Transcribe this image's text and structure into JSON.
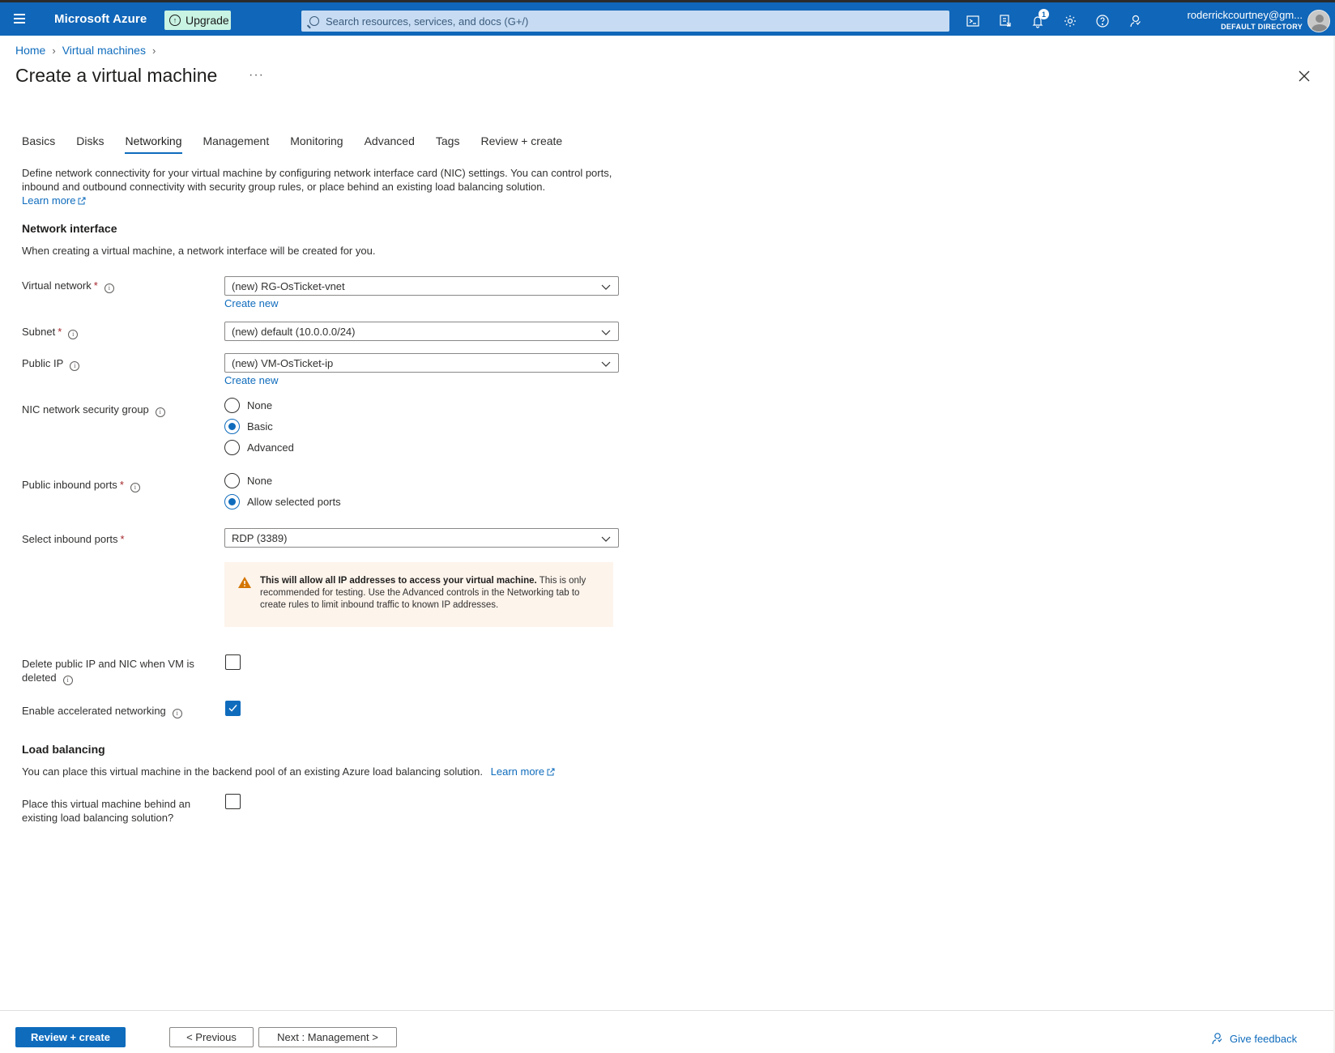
{
  "topbar": {
    "brand": "Microsoft Azure",
    "upgrade_label": "Upgrade",
    "search_placeholder": "Search resources, services, and docs (G+/)",
    "notification_count": "1",
    "account_email": "roderrickcourtney@gm...",
    "account_directory": "DEFAULT DIRECTORY",
    "icons": [
      "cloud-shell-icon",
      "directory-filter-icon",
      "notifications-icon",
      "settings-icon",
      "help-icon",
      "feedback-icon"
    ]
  },
  "breadcrumb": {
    "home": "Home",
    "virtual_machines": "Virtual machines"
  },
  "page": {
    "title": "Create a virtual machine",
    "more": "···"
  },
  "tabs": [
    "Basics",
    "Disks",
    "Networking",
    "Management",
    "Monitoring",
    "Advanced",
    "Tags",
    "Review + create"
  ],
  "active_tab": "Networking",
  "intro": {
    "text": "Define network connectivity for your virtual machine by configuring network interface card (NIC) settings. You can control ports, inbound and outbound connectivity with security group rules, or place behind an existing load balancing solution.",
    "learn_more": "Learn more"
  },
  "network_interface": {
    "title": "Network interface",
    "description": "When creating a virtual machine, a network interface will be created for you.",
    "virtual_network": {
      "label": "Virtual network",
      "value": "(new) RG-OsTicket-vnet",
      "create_new": "Create new"
    },
    "subnet": {
      "label": "Subnet",
      "value": "(new) default (10.0.0.0/24)"
    },
    "public_ip": {
      "label": "Public IP",
      "value": "(new) VM-OsTicket-ip",
      "create_new": "Create new"
    },
    "nsg": {
      "label": "NIC network security group",
      "options": [
        "None",
        "Basic",
        "Advanced"
      ],
      "selected": "Basic"
    },
    "inbound_ports": {
      "label": "Public inbound ports",
      "options": [
        "None",
        "Allow selected ports"
      ],
      "selected": "Allow selected ports"
    },
    "select_ports": {
      "label": "Select inbound ports",
      "value": "RDP (3389)"
    },
    "warning": {
      "bold": "This will allow all IP addresses to access your virtual machine.",
      "text": " This is only recommended for testing.  Use the Advanced controls in the Networking tab to create rules to limit inbound traffic to known IP addresses."
    },
    "delete_ip": {
      "label_line1": "Delete public IP and NIC when VM is",
      "label_line2": "deleted",
      "checked": false
    },
    "accelerated": {
      "label": "Enable accelerated networking",
      "checked": true
    }
  },
  "load_balancing": {
    "title": "Load balancing",
    "description": "You can place this virtual machine in the backend pool of an existing Azure load balancing solution.",
    "learn_more": "Learn more",
    "place_behind": {
      "label_line1": "Place this virtual machine behind an",
      "label_line2": "existing load balancing solution?",
      "checked": false
    }
  },
  "footer": {
    "review_create": "Review + create",
    "previous": "< Previous",
    "next": "Next : Management >",
    "give_feedback": "Give feedback"
  },
  "colors": {
    "azure_blue": "#1066b8",
    "link": "#0f6cbd",
    "upgrade_bg": "#c9f3e3",
    "warning_bg": "#fdf4ec",
    "warning_icon": "#d47500",
    "required": "#a4262c"
  }
}
